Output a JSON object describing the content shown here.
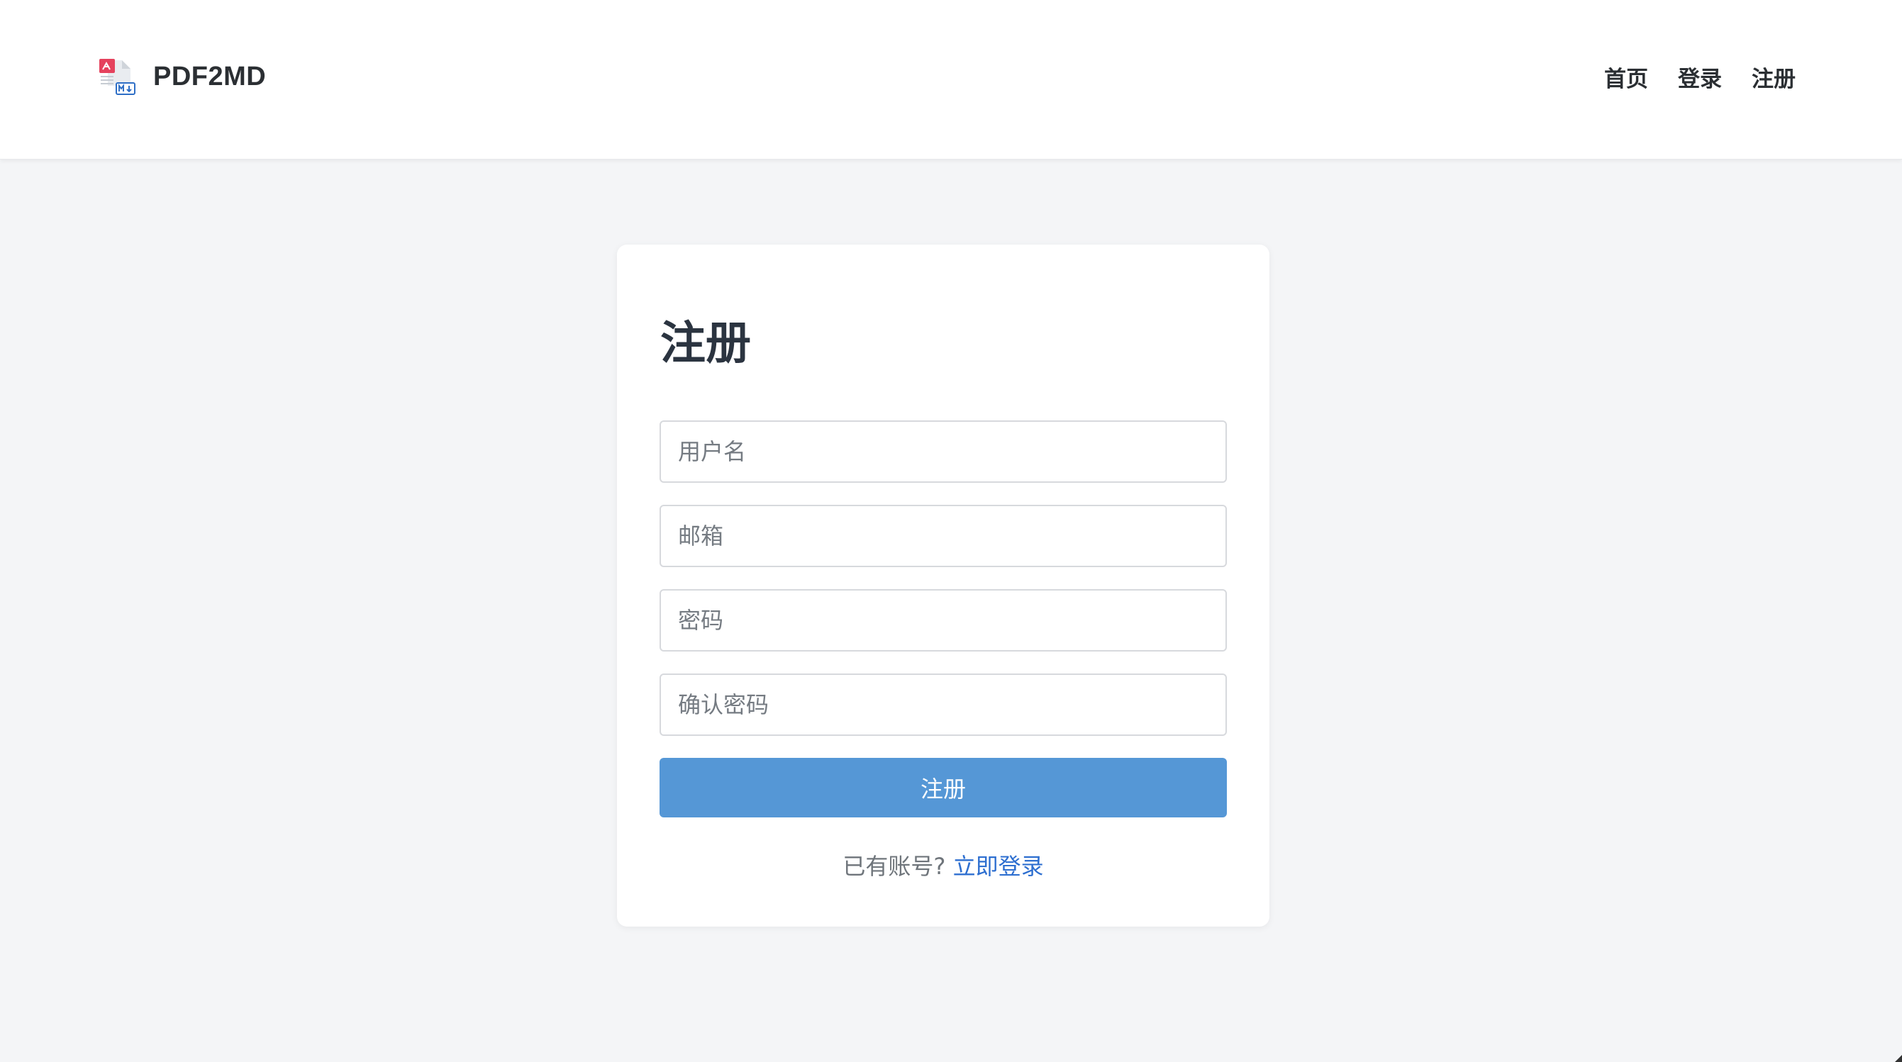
{
  "header": {
    "brand": "PDF2MD",
    "logo_icon": "pdf-to-markdown-icon",
    "nav": [
      {
        "label": "首页"
      },
      {
        "label": "登录"
      },
      {
        "label": "注册"
      }
    ]
  },
  "form": {
    "title": "注册",
    "fields": {
      "username": {
        "placeholder": "用户名",
        "value": ""
      },
      "email": {
        "placeholder": "邮箱",
        "value": ""
      },
      "password": {
        "placeholder": "密码",
        "value": ""
      },
      "confirm_password": {
        "placeholder": "确认密码",
        "value": ""
      }
    },
    "submit_label": "注册",
    "footer_text": "已有账号?",
    "login_link": "立即登录"
  },
  "colors": {
    "background": "#f4f5f7",
    "primary": "#5597d6",
    "link": "#2e6fd0",
    "logo_red": "#e5425d",
    "logo_blue": "#2f6fc6"
  }
}
